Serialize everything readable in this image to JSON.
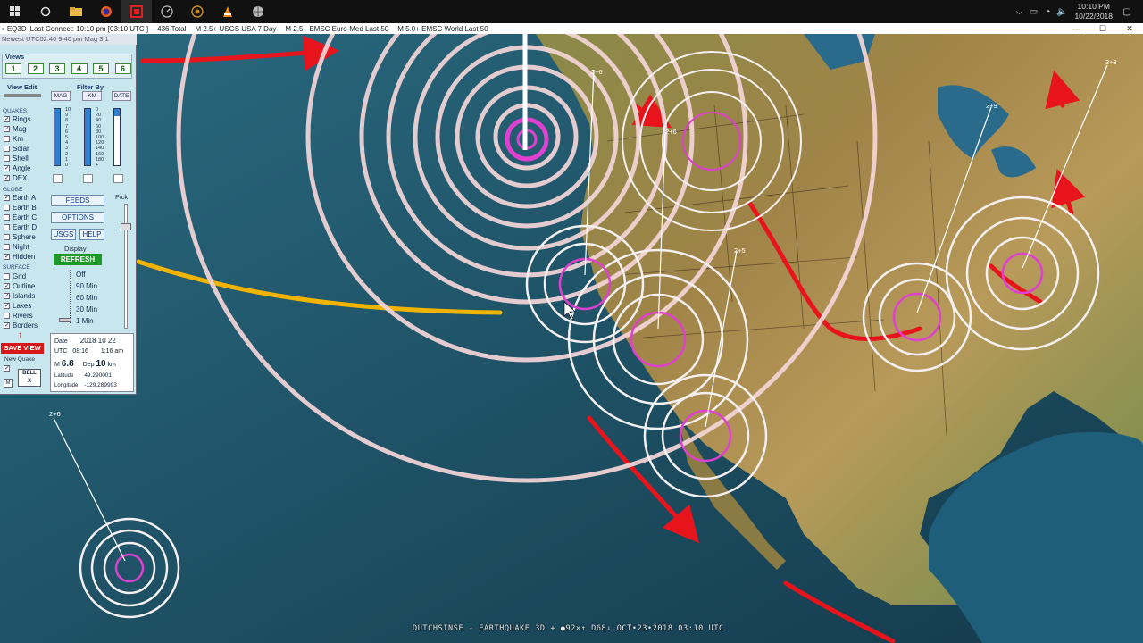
{
  "taskbar": {
    "time": "10:10 PM",
    "date": "10/22/2018",
    "icons": [
      "windows-icon",
      "cortana-icon",
      "file-explorer-icon",
      "firefox-icon",
      "eq3d-app-icon",
      "speedometer-icon",
      "ring-app-icon",
      "vlc-icon",
      "globe-app-icon"
    ]
  },
  "app": {
    "name": "EQ3D",
    "last_connect": "Last Connect: 10:10 pm [03:10 UTC ]",
    "total": "436  Total",
    "feed1": "M 2.5+  USGS USA 7 Day",
    "feed2": "M 2.5+  EMSC Euro-Med Last 50",
    "feed3": "M 5.0+  EMSC World Last 50",
    "newest": "Newest UTC02:40  9:40 pm  Mag 3.1"
  },
  "panel": {
    "views_title": "Views",
    "views": [
      "1",
      "2",
      "3",
      "4",
      "5",
      "6"
    ],
    "view_edit": "View Edit",
    "filter_by": "Filter By",
    "filters": [
      "MAG",
      "KM",
      "DATE"
    ],
    "mag_scale": [
      "10",
      "9",
      "8",
      "7",
      "6",
      "5",
      "4",
      "3",
      "2",
      "1",
      "0"
    ],
    "km_scale": [
      "0",
      "20",
      "40",
      "60",
      "80",
      "100",
      "120",
      "140",
      "160",
      "180",
      "+"
    ],
    "quakes_group": "QUAKES",
    "quakes": [
      {
        "label": "Rings",
        "checked": true
      },
      {
        "label": "Mag",
        "checked": true
      },
      {
        "label": "Km",
        "checked": false
      },
      {
        "label": "Solar",
        "checked": false
      },
      {
        "label": "Shell",
        "checked": false
      },
      {
        "label": "Angle",
        "checked": true
      },
      {
        "label": "DEX",
        "checked": true
      }
    ],
    "globe_group": "GLOBE",
    "globe": [
      {
        "label": "Earth A",
        "checked": true
      },
      {
        "label": "Earth B",
        "checked": false
      },
      {
        "label": "Earth C",
        "checked": false
      },
      {
        "label": "Earth D",
        "checked": false
      },
      {
        "label": "Sphere",
        "checked": false
      },
      {
        "label": "Night",
        "checked": false
      },
      {
        "label": "Hidden",
        "checked": true
      }
    ],
    "surface_group": "SURFACE",
    "surface": [
      {
        "label": "Grid",
        "checked": false
      },
      {
        "label": "Outline",
        "checked": true
      },
      {
        "label": "Islands",
        "checked": true
      },
      {
        "label": "Lakes",
        "checked": true
      },
      {
        "label": "Rivers",
        "checked": false
      },
      {
        "label": "Borders",
        "checked": true
      }
    ],
    "feeds": "FEEDS",
    "options": "OPTIONS",
    "usgs": "USGS",
    "help": "HELP",
    "display": "Display",
    "refresh": "REFRESH",
    "pick": "Pick",
    "display_options": [
      "Off",
      "90 Min",
      "60 Min",
      "30 Min",
      "1 Min"
    ],
    "save_view": "SAVE VIEW",
    "new_quake": "New Quake",
    "bell": "BELL",
    "bell_x": "X",
    "m_btn": "M"
  },
  "quake_info": {
    "date_label": "Date",
    "date": "2018  10  22",
    "utc_label": "UTC",
    "utc": "08:16",
    "local": "1:16 am",
    "mag_label": "M",
    "mag": "6.8",
    "dep_label": "Dep",
    "dep": "10",
    "dep_unit": "km",
    "lat_label": "Latitude",
    "lat": "49.290001",
    "lon_label": "Longitude",
    "lon": "-129.289993"
  },
  "map_labels": {
    "a": "2+6",
    "b": "2+6",
    "c": "2+9",
    "d": "3+3",
    "e": "2+5",
    "f": "2+6"
  },
  "caption": "DUTCHSINSE - EARTHQUAKE 3D  +  ●92×↑ D68↓ OCT•23•2018 03:10 UTC",
  "colors": {
    "ocean": "#1d4f63",
    "land": "#9a8a4a",
    "ring": "#f4d6d8",
    "magenta": "#e040d0",
    "arrow_red": "#e8141c",
    "arrow_yellow": "#f0b400",
    "refresh_green": "#1f9a2a",
    "save_red": "#d81818"
  }
}
